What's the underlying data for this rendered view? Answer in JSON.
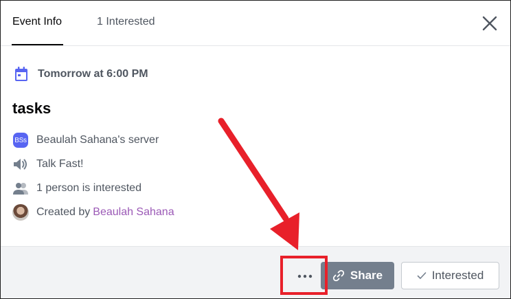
{
  "tabs": [
    {
      "label": "Event Info",
      "active": true
    },
    {
      "label": "1 Interested",
      "active": false
    }
  ],
  "event": {
    "when": "Tomorrow at 6:00 PM",
    "title": "tasks",
    "server_badge": "BSs",
    "server_name": "Beaulah Sahana's server",
    "channel": "Talk Fast!",
    "interested_count_text": "1 person is interested",
    "created_by_prefix": "Created by",
    "creator_name": "Beaulah Sahana"
  },
  "footer": {
    "more_label": "•••",
    "share_label": "Share",
    "interested_label": "Interested"
  },
  "colors": {
    "brand": "#5865f2",
    "share_bg": "#747f8d",
    "creator_link": "#9b59b6",
    "annotation": "#e8202a"
  }
}
